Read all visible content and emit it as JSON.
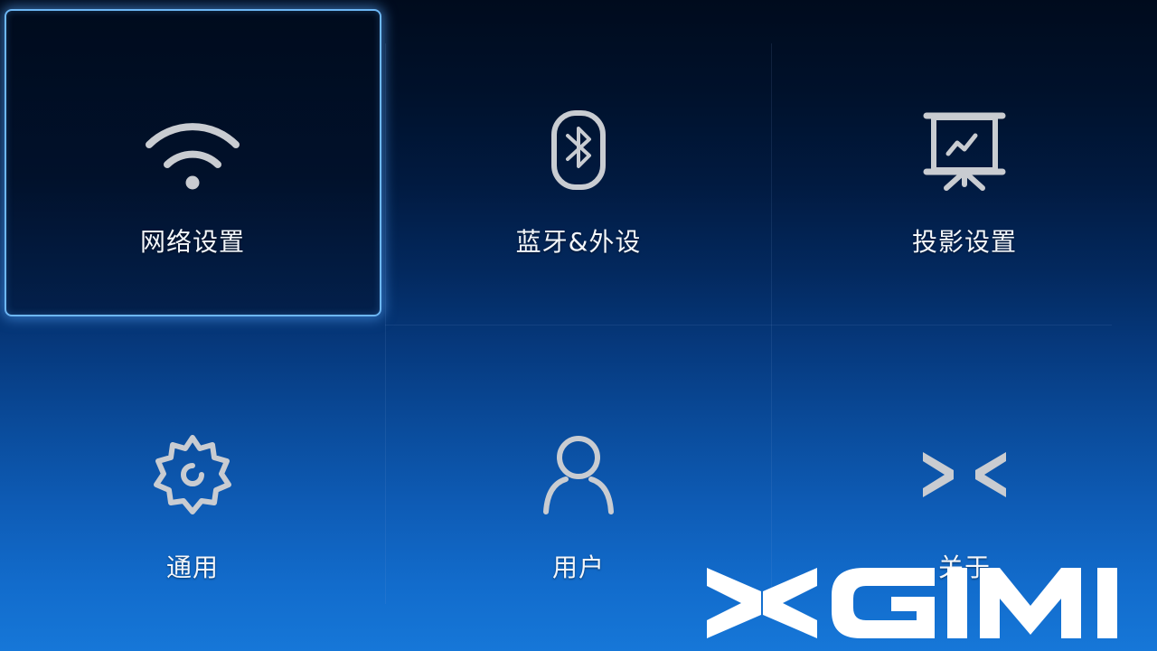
{
  "menu": {
    "items": [
      {
        "label": "网络设置",
        "icon": "wifi-icon",
        "focused": true
      },
      {
        "label": "蓝牙&外设",
        "icon": "bluetooth-icon",
        "focused": false
      },
      {
        "label": "投影设置",
        "icon": "projector-screen-icon",
        "focused": false
      },
      {
        "label": "通用",
        "icon": "gear-icon",
        "focused": false
      },
      {
        "label": "用户",
        "icon": "user-icon",
        "focused": false
      },
      {
        "label": "关于",
        "icon": "xgimi-symbol-icon",
        "focused": false
      }
    ]
  },
  "brand": {
    "logo_text": "XGIMI",
    "icon": "xgimi-logo"
  },
  "colors": {
    "focus_border": "#6db7f5",
    "icon_gray": "#c9ccd1",
    "background_top": "#000b1d",
    "background_bottom": "#1677d8"
  }
}
